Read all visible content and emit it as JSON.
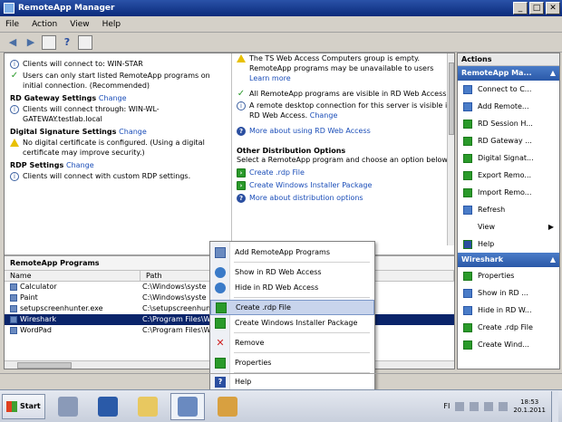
{
  "window": {
    "title": "RemoteApp Manager",
    "buttons": [
      "_",
      "□",
      "✕"
    ]
  },
  "menubar": [
    "File",
    "Action",
    "View",
    "Help"
  ],
  "overview": {
    "left": {
      "rows": [
        {
          "icon": "info-icon",
          "text": "Clients will connect to: WIN-STAR"
        },
        {
          "icon": "check-icon",
          "text": "Users can only start listed RemoteApp programs on initial connection. (Recommended)"
        }
      ],
      "gateway": {
        "title": "RD Gateway Settings",
        "change": "Change",
        "text": "Clients will connect through: WIN-WL-GATEWAY.testlab.local"
      },
      "signature": {
        "title": "Digital Signature Settings",
        "change": "Change",
        "text": "No digital certificate is configured. (Using a digital certificate may improve security.)"
      },
      "rdp": {
        "title": "RDP Settings",
        "change": "Change",
        "text": "Clients will connect with custom RDP settings."
      }
    },
    "right": {
      "warn_text": "The TS Web Access Computers group is empty. RemoteApp programs may be unavailable to users",
      "learn_more": "Learn more",
      "visible_text": "All RemoteApp programs are visible in RD Web Access.",
      "remote_text": "A remote desktop connection for this server is visible in RD Web Access.",
      "remote_change": "Change",
      "more_web": "More about using RD Web Access",
      "other_title": "Other Distribution Options",
      "other_desc": "Select a RemoteApp program and choose an option below.",
      "create_rdp": "Create .rdp File",
      "create_msi": "Create Windows Installer Package",
      "more_dist": "More about distribution options"
    }
  },
  "programs": {
    "title": "RemoteApp Programs",
    "columns": [
      "Name",
      "Path"
    ],
    "rows": [
      {
        "name": "Calculator",
        "path": "C:\\Windows\\syste"
      },
      {
        "name": "Paint",
        "path": "C:\\Windows\\syste"
      },
      {
        "name": "setupscreenhunter.exe",
        "path": "C:\\setupscreenhun"
      },
      {
        "name": "Wireshark",
        "path": "C:\\Program Files\\W",
        "selected": true
      },
      {
        "name": "WordPad",
        "path": "C:\\Program Files\\W"
      }
    ]
  },
  "context_menu": [
    {
      "label": "Add RemoteApp Programs",
      "icon": "add-programs-icon"
    },
    {
      "label": "Show in RD Web Access",
      "icon": "globe-icon"
    },
    {
      "label": "Hide in RD Web Access",
      "icon": "globe-icon"
    },
    {
      "label": "Create .rdp File",
      "icon": "rdp-file-icon",
      "highlighted": true
    },
    {
      "label": "Create Windows Installer Package",
      "icon": "installer-icon"
    },
    {
      "label": "Remove",
      "icon": "remove-icon"
    },
    {
      "label": "Properties",
      "icon": "properties-icon"
    },
    {
      "label": "Help",
      "icon": "help-icon"
    }
  ],
  "actions": {
    "header": "Actions",
    "group1": "RemoteApp Ma...",
    "items1": [
      "Connect to C...",
      "Add Remote...",
      "RD Session H...",
      "RD Gateway ...",
      "Digital Signat...",
      "Export Remo...",
      "Import Remo...",
      "Refresh",
      "View",
      "Help"
    ],
    "group2": "Wireshark",
    "items2": [
      "Properties",
      "Show in RD ...",
      "Hide in RD W...",
      "Create .rdp File",
      "Create Wind..."
    ]
  },
  "taskbar": {
    "start": "Start",
    "lang": "FI",
    "time": "18:53",
    "date": "20.1.2011"
  }
}
